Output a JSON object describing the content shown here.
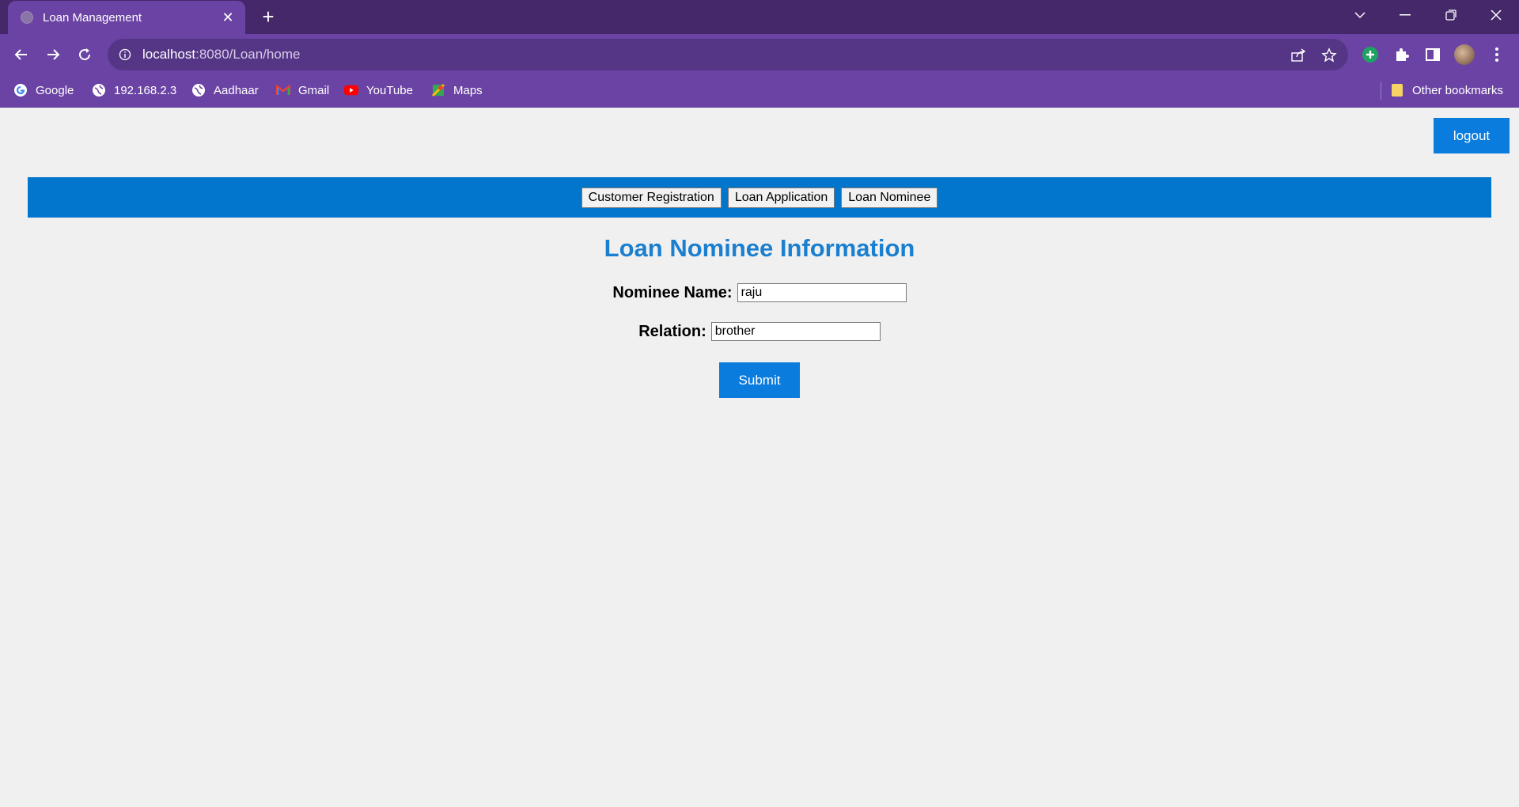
{
  "browser": {
    "tab_title": "Loan Management",
    "url_host": "localhost",
    "url_path": ":8080/Loan/home",
    "bookmarks": [
      "Google",
      "192.168.2.3",
      "Aadhaar",
      "Gmail",
      "YouTube",
      "Maps"
    ],
    "other_bookmarks": "Other bookmarks"
  },
  "page": {
    "logout_label": "logout",
    "nav": [
      "Customer Registration",
      "Loan Application",
      "Loan Nominee"
    ],
    "heading": "Loan Nominee Information",
    "form": {
      "nominee_name_label": "Nominee Name:",
      "nominee_name_value": "raju",
      "relation_label": "Relation:",
      "relation_value": "brother",
      "submit_label": "Submit"
    }
  },
  "colors": {
    "chrome_dark": "#45286a",
    "chrome": "#6b43a4",
    "accent_blue": "#0275cc",
    "heading_blue": "#1b7fd0"
  }
}
